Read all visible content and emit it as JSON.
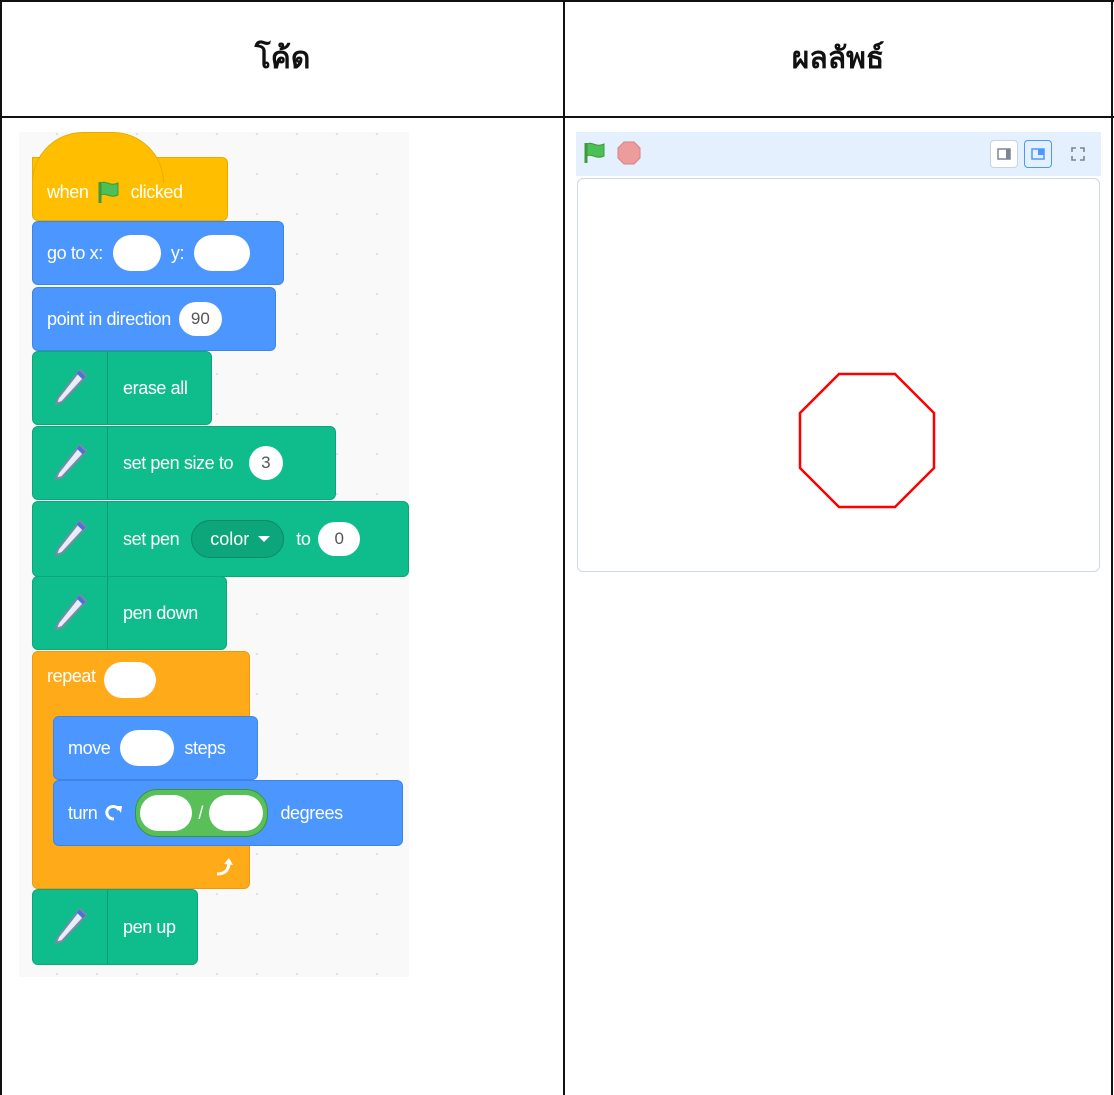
{
  "headers": {
    "code": "โค้ด",
    "result": "ผลลัพธ์"
  },
  "blocks": {
    "when": "when",
    "clicked": "clicked",
    "goto_x": "go to x:",
    "y": "y:",
    "point_dir": "point in direction",
    "point_dir_value": "90",
    "erase_all": "erase all",
    "set_pen_size": "set pen size to",
    "pen_size_value": "3",
    "set_pen": "set pen",
    "color_option": "color",
    "to": "to",
    "color_value": "0",
    "pen_down": "pen down",
    "repeat": "repeat",
    "move": "move",
    "steps": "steps",
    "turn": "turn",
    "divide": "/",
    "degrees": "degrees",
    "pen_up": "pen up"
  },
  "stage": {
    "shape": "octagon",
    "stroke_color": "#ff0000",
    "flag_color": "#4cbf56",
    "stop_color": "#ec9c9c"
  },
  "colors": {
    "events": "#ffbf00",
    "motion": "#4c97ff",
    "pen": "#0fbd8c",
    "control": "#ffab19"
  }
}
